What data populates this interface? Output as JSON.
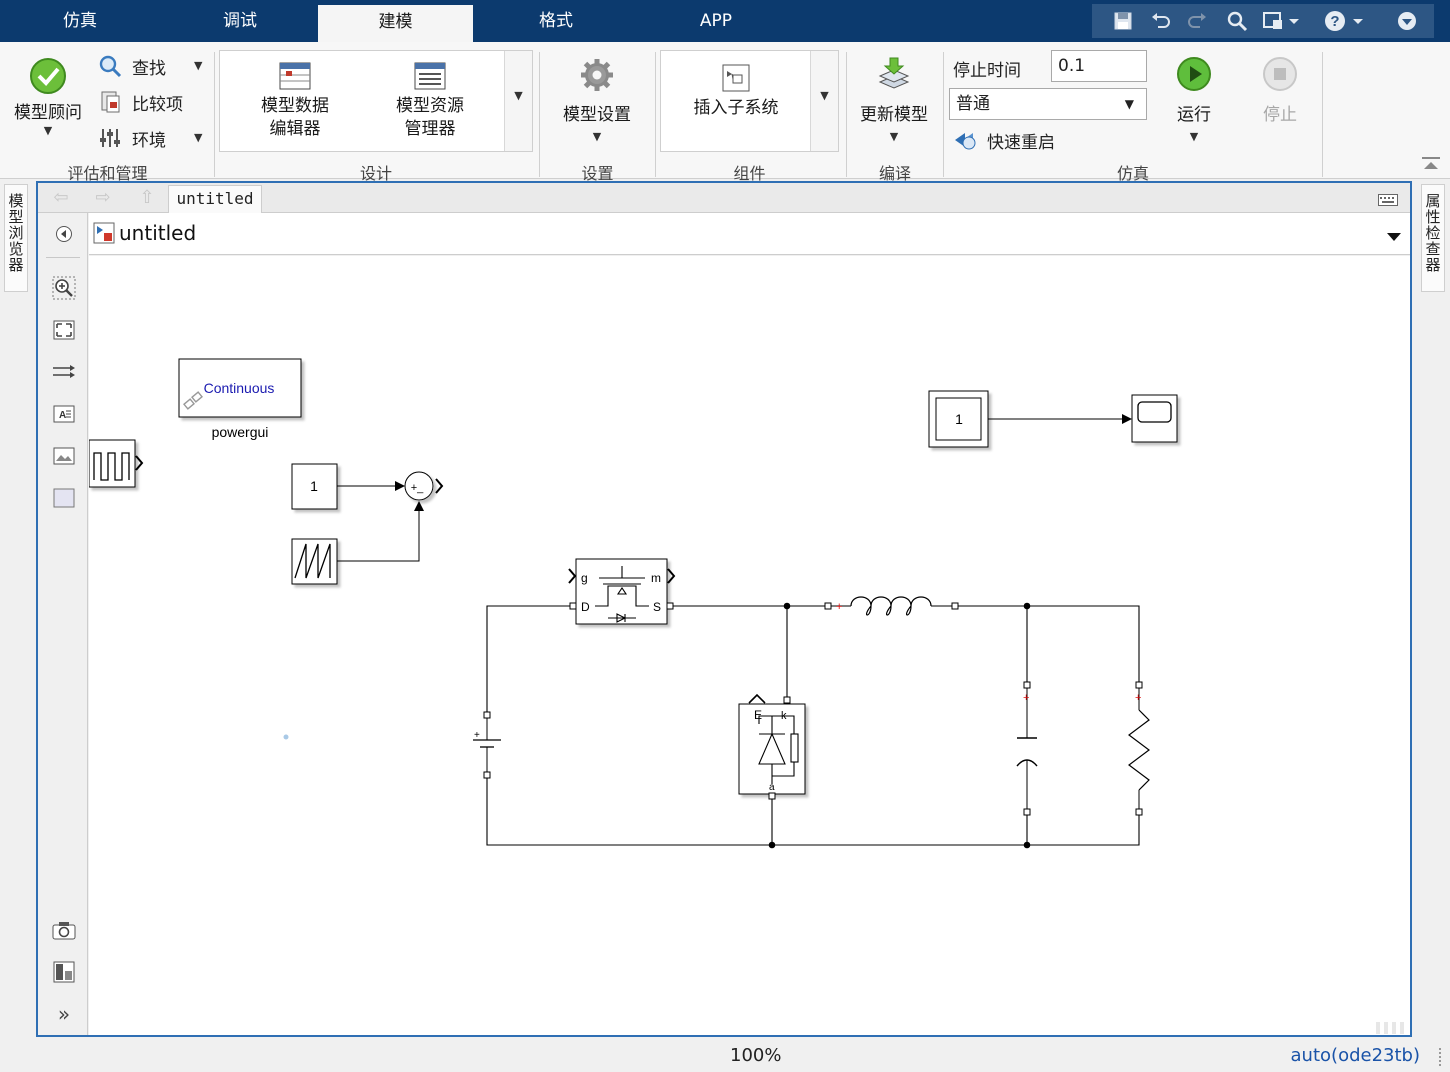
{
  "tabs": [
    "仿真",
    "调试",
    "建模",
    "格式",
    "APP"
  ],
  "active_tab": "建模",
  "quick_access": [
    "save-icon",
    "undo-icon",
    "redo-icon",
    "search-icon",
    "window-icon",
    "help-icon",
    "collapse-icon"
  ],
  "ribbon": {
    "evaluate": {
      "advisor": "模型顾问",
      "find": "查找",
      "compare": "比较项",
      "environment": "环境",
      "label": "评估和管理"
    },
    "design": {
      "data_editor_line1": "模型数据",
      "data_editor_line2": "编辑器",
      "explorer_line1": "模型资源",
      "explorer_line2": "管理器",
      "label": "设计"
    },
    "settings": {
      "model_settings": "模型设置",
      "label": "设置"
    },
    "components": {
      "insert_subsystem": "插入子系统",
      "label": "组件"
    },
    "compile": {
      "update_model": "更新模型",
      "label": "编译"
    },
    "simulation": {
      "stop_time_label": "停止时间",
      "stop_time_value": "0.1",
      "mode_value": "普通",
      "fast_restart": "快速重启",
      "run": "运行",
      "stop": "停止",
      "label": "仿真"
    }
  },
  "side": {
    "left_tab": "模型浏览器",
    "right_tab": "属性检查器"
  },
  "editor": {
    "tab": "untitled",
    "address": "untitled"
  },
  "diagram": {
    "powergui_text": "Continuous",
    "powergui_label": "powergui",
    "const1": "1",
    "const2": "1",
    "sum_signs": "+_",
    "mosfet_g": "g",
    "mosfet_m": "m",
    "mosfet_d": "D",
    "mosfet_s": "S",
    "diode_e": "E",
    "diode_k": "k",
    "diode_a": "a",
    "dc_plus": "+"
  },
  "status": {
    "zoom": "100%",
    "solver": "auto(ode23tb)"
  }
}
